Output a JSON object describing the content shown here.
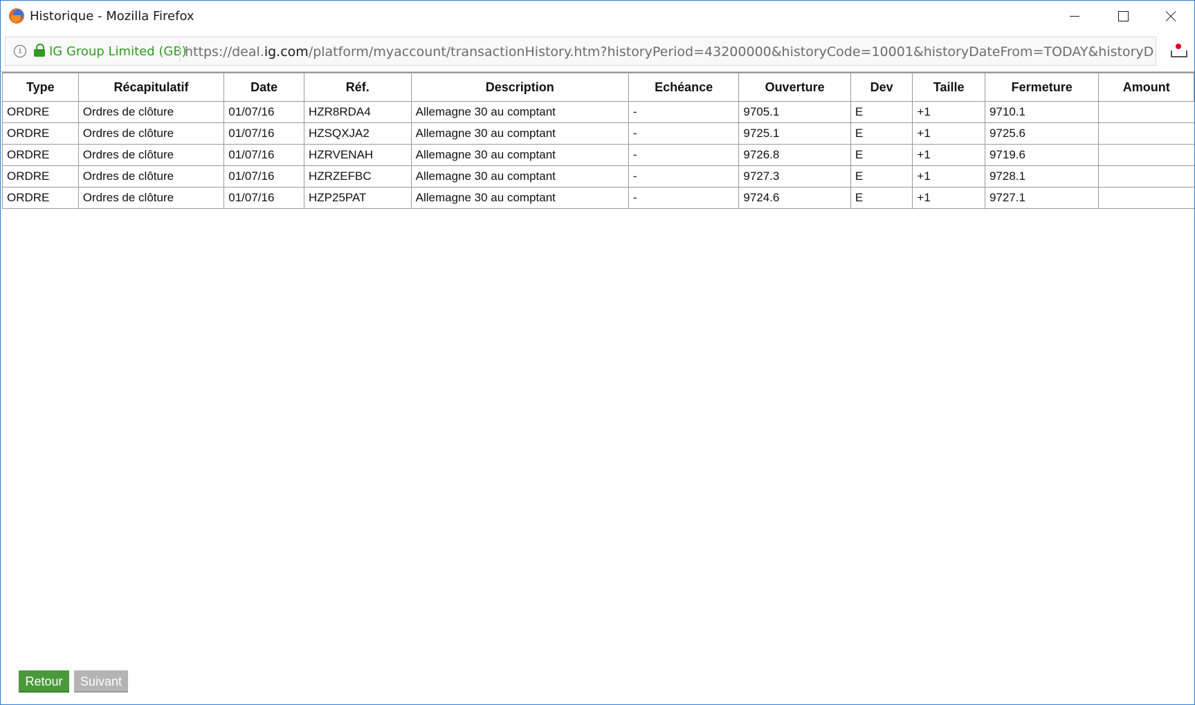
{
  "window": {
    "title": "Historique - Mozilla Firefox"
  },
  "urlbar": {
    "org": "IG Group Limited (GB)",
    "url_prefix": "https://deal.",
    "url_domain": "ig.com",
    "url_rest": "/platform/myaccount/transactionHistory.htm?historyPeriod=43200000&historyCode=10001&historyDateFrom=TODAY&historyDateTo"
  },
  "table": {
    "headers": [
      "Type",
      "Récapitulatif",
      "Date",
      "Réf.",
      "Description",
      "Echéance",
      "Ouverture",
      "Dev",
      "Taille",
      "Fermeture",
      "Amount"
    ],
    "rows": [
      [
        "ORDRE",
        "Ordres de clôture",
        "01/07/16",
        "HZR8RDA4",
        "Allemagne 30 au comptant",
        "-",
        "9705.1",
        "E",
        "+1",
        "9710.1"
      ],
      [
        "ORDRE",
        "Ordres de clôture",
        "01/07/16",
        "HZSQXJA2",
        "Allemagne 30 au comptant",
        "-",
        "9725.1",
        "E",
        "+1",
        "9725.6"
      ],
      [
        "ORDRE",
        "Ordres de clôture",
        "01/07/16",
        "HZRVENAH",
        "Allemagne 30 au comptant",
        "-",
        "9726.8",
        "E",
        "+1",
        "9719.6"
      ],
      [
        "ORDRE",
        "Ordres de clôture",
        "01/07/16",
        "HZRZEFBC",
        "Allemagne 30 au comptant",
        "-",
        "9727.3",
        "E",
        "+1",
        "9728.1"
      ],
      [
        "ORDRE",
        "Ordres de clôture",
        "01/07/16",
        "HZP25PAT",
        "Allemagne 30 au comptant",
        "-",
        "9724.6",
        "E",
        "+1",
        "9727.1"
      ]
    ]
  },
  "buttons": {
    "back": "Retour",
    "next": "Suivant"
  },
  "colors": {
    "accent_green": "#4a9a3a",
    "disabled_gray": "#b4b4b4",
    "secure_green": "#2f9c1f",
    "window_border": "#2b7bd6"
  }
}
